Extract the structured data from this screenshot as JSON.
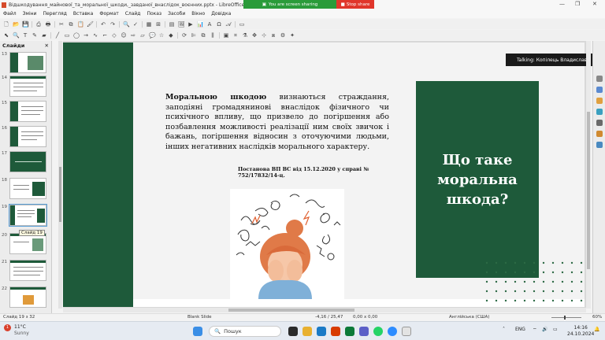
{
  "window": {
    "title": "Відшкодування_майнової_та_моральної_шкоди,_завданої_внаслідок_воєнних.pptx - LibreOffice Impress"
  },
  "share": {
    "sharing_label": "You are screen sharing",
    "stop_label": "Stop share"
  },
  "menu": [
    "Файл",
    "Зміни",
    "Перегляд",
    "Вставка",
    "Формат",
    "Слайд",
    "Показ",
    "Засоби",
    "Вікно",
    "Довідка"
  ],
  "slides_pane": {
    "header": "Слайди",
    "thumbnails": [
      {
        "num": "13"
      },
      {
        "num": "14"
      },
      {
        "num": "15"
      },
      {
        "num": "16"
      },
      {
        "num": "17"
      },
      {
        "num": "18"
      },
      {
        "num": "19"
      },
      {
        "num": "20"
      },
      {
        "num": "21"
      },
      {
        "num": "22"
      }
    ],
    "tooltip": "Слайд 19"
  },
  "slide": {
    "term": "Моральною шкодою",
    "paragraph": " визнаються страждання, заподіяні громадянинові внаслідок фізичного чи психічного впливу, що призвело до погіршення або позбавлення можливості реалізації ним своїх звичок і бажань, погіршення відносин з оточуючими людьми, інших негативних наслідків морального характеру.",
    "citation": "Постанова ВП ВС від 15.12.2020 у справі № 752/17832/14-ц.",
    "box_text": "Що таке\nморальна\nшкода?",
    "accent_color": "#1e5a3a"
  },
  "talking": "Talking: Копілець Владислава",
  "status": {
    "slide_pos": "Слайд 19 з 32",
    "layout": "Blank Slide",
    "position": "-4,16 / 25,47",
    "size": "0,00 x 0,00",
    "language": "Англійська (США)",
    "zoom": "60%"
  },
  "taskbar": {
    "weather_temp": "11°C",
    "weather_desc": "Sunny",
    "weather_badge": "1",
    "search_placeholder": "Пошук",
    "lang": "ENG",
    "time": "14:16",
    "date": "24.10.2024"
  }
}
